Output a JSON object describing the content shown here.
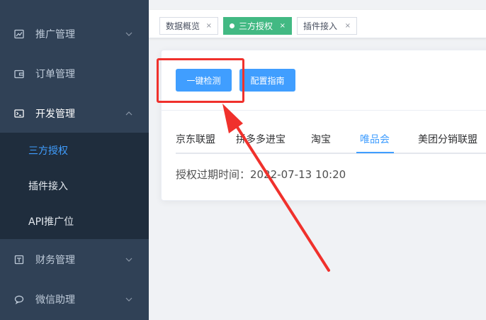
{
  "sidebar": {
    "items": [
      {
        "label": "推广管理",
        "icon": "chart-icon"
      },
      {
        "label": "订单管理",
        "icon": "wallet-icon"
      },
      {
        "label": "开发管理",
        "icon": "terminal-icon"
      },
      {
        "label": "财务管理",
        "icon": "finance-icon"
      },
      {
        "label": "微信助理",
        "icon": "wechat-icon"
      }
    ],
    "sub_items": [
      {
        "label": "三方授权"
      },
      {
        "label": "插件接入"
      },
      {
        "label": "API推广位"
      }
    ]
  },
  "tags": [
    {
      "label": "数据概览",
      "close": "×"
    },
    {
      "label": "三方授权",
      "close": "×"
    },
    {
      "label": "插件接入",
      "close": "×"
    }
  ],
  "toolbar": {
    "check_label": "一键检测",
    "guide_label": "配置指南"
  },
  "tabs": [
    "京东联盟",
    "拼多多进宝",
    "淘宝",
    "唯品会",
    "美团分销联盟"
  ],
  "active_tab": "唯品会",
  "expire_text": "授权过期时间：2022-07-13 10:20",
  "colors": {
    "sidebar_bg": "#304156",
    "submenu_bg": "#1f2d3d",
    "accent": "#409eff",
    "active_tag": "#42b983",
    "annotation": "#f0312c"
  }
}
